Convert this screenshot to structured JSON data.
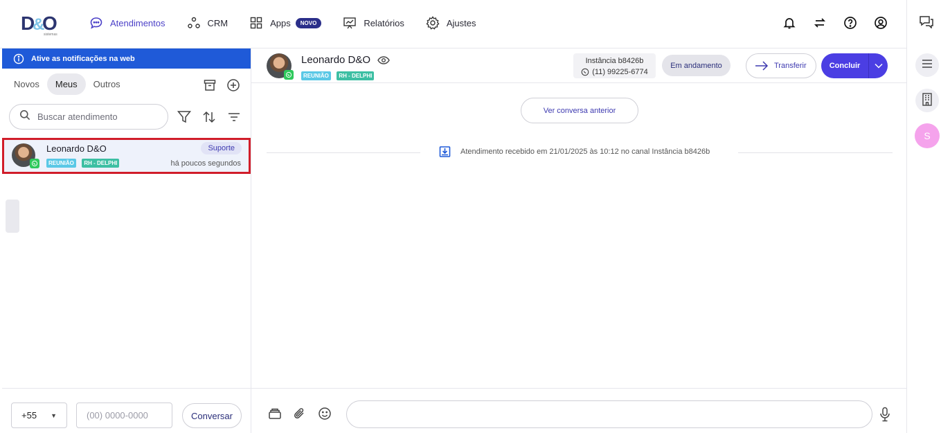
{
  "brand": {
    "logo_text": "D&O",
    "logo_subtext": "sistemas"
  },
  "nav": {
    "items": [
      {
        "label": "Atendimentos",
        "icon": "chat-bubble-icon",
        "active": true
      },
      {
        "label": "CRM",
        "icon": "network-icon"
      },
      {
        "label": "Apps",
        "icon": "grid-icon",
        "badge": "NOVO"
      },
      {
        "label": "Relatórios",
        "icon": "presentation-chart-icon"
      },
      {
        "label": "Ajustes",
        "icon": "gear-icon"
      }
    ]
  },
  "header_icons": [
    "bell-icon",
    "swap-arrows-icon",
    "help-circle-icon",
    "user-circle-icon"
  ],
  "left": {
    "notification": "Ative as notificações na web",
    "tabs": [
      "Novos",
      "Meus",
      "Outros"
    ],
    "active_tab": "Meus",
    "search_placeholder": "Buscar atendimento",
    "conversation": {
      "name": "Leonardo D&O",
      "tags": [
        "REUNIÃO",
        "RH - DELPHI"
      ],
      "queue": "Suporte",
      "time": "há poucos segundos"
    },
    "footer": {
      "country_code": "+55",
      "phone_placeholder": "(00) 0000-0000",
      "button": "Conversar"
    }
  },
  "chat": {
    "contact_name": "Leonardo D&O",
    "tags": [
      "REUNIÃO",
      "RH - DELPHI"
    ],
    "instance_label": "Instância b8426b",
    "instance_phone": "(11) 99225-6774",
    "status": "Em andamento",
    "transfer_label": "Transferir",
    "conclude_label": "Concluir",
    "previous_button": "Ver conversa anterior",
    "system_message": "Atendimento recebido em 21/01/2025 às 10:12 no canal Instância b8426b",
    "composer_placeholder": ""
  },
  "rail": {
    "avatar_initial": "S"
  },
  "colors": {
    "accent": "#4b3ee3",
    "notification_bar": "#1f5ad8",
    "selection_border": "#d11d2a",
    "whatsapp": "#2fc95c"
  }
}
